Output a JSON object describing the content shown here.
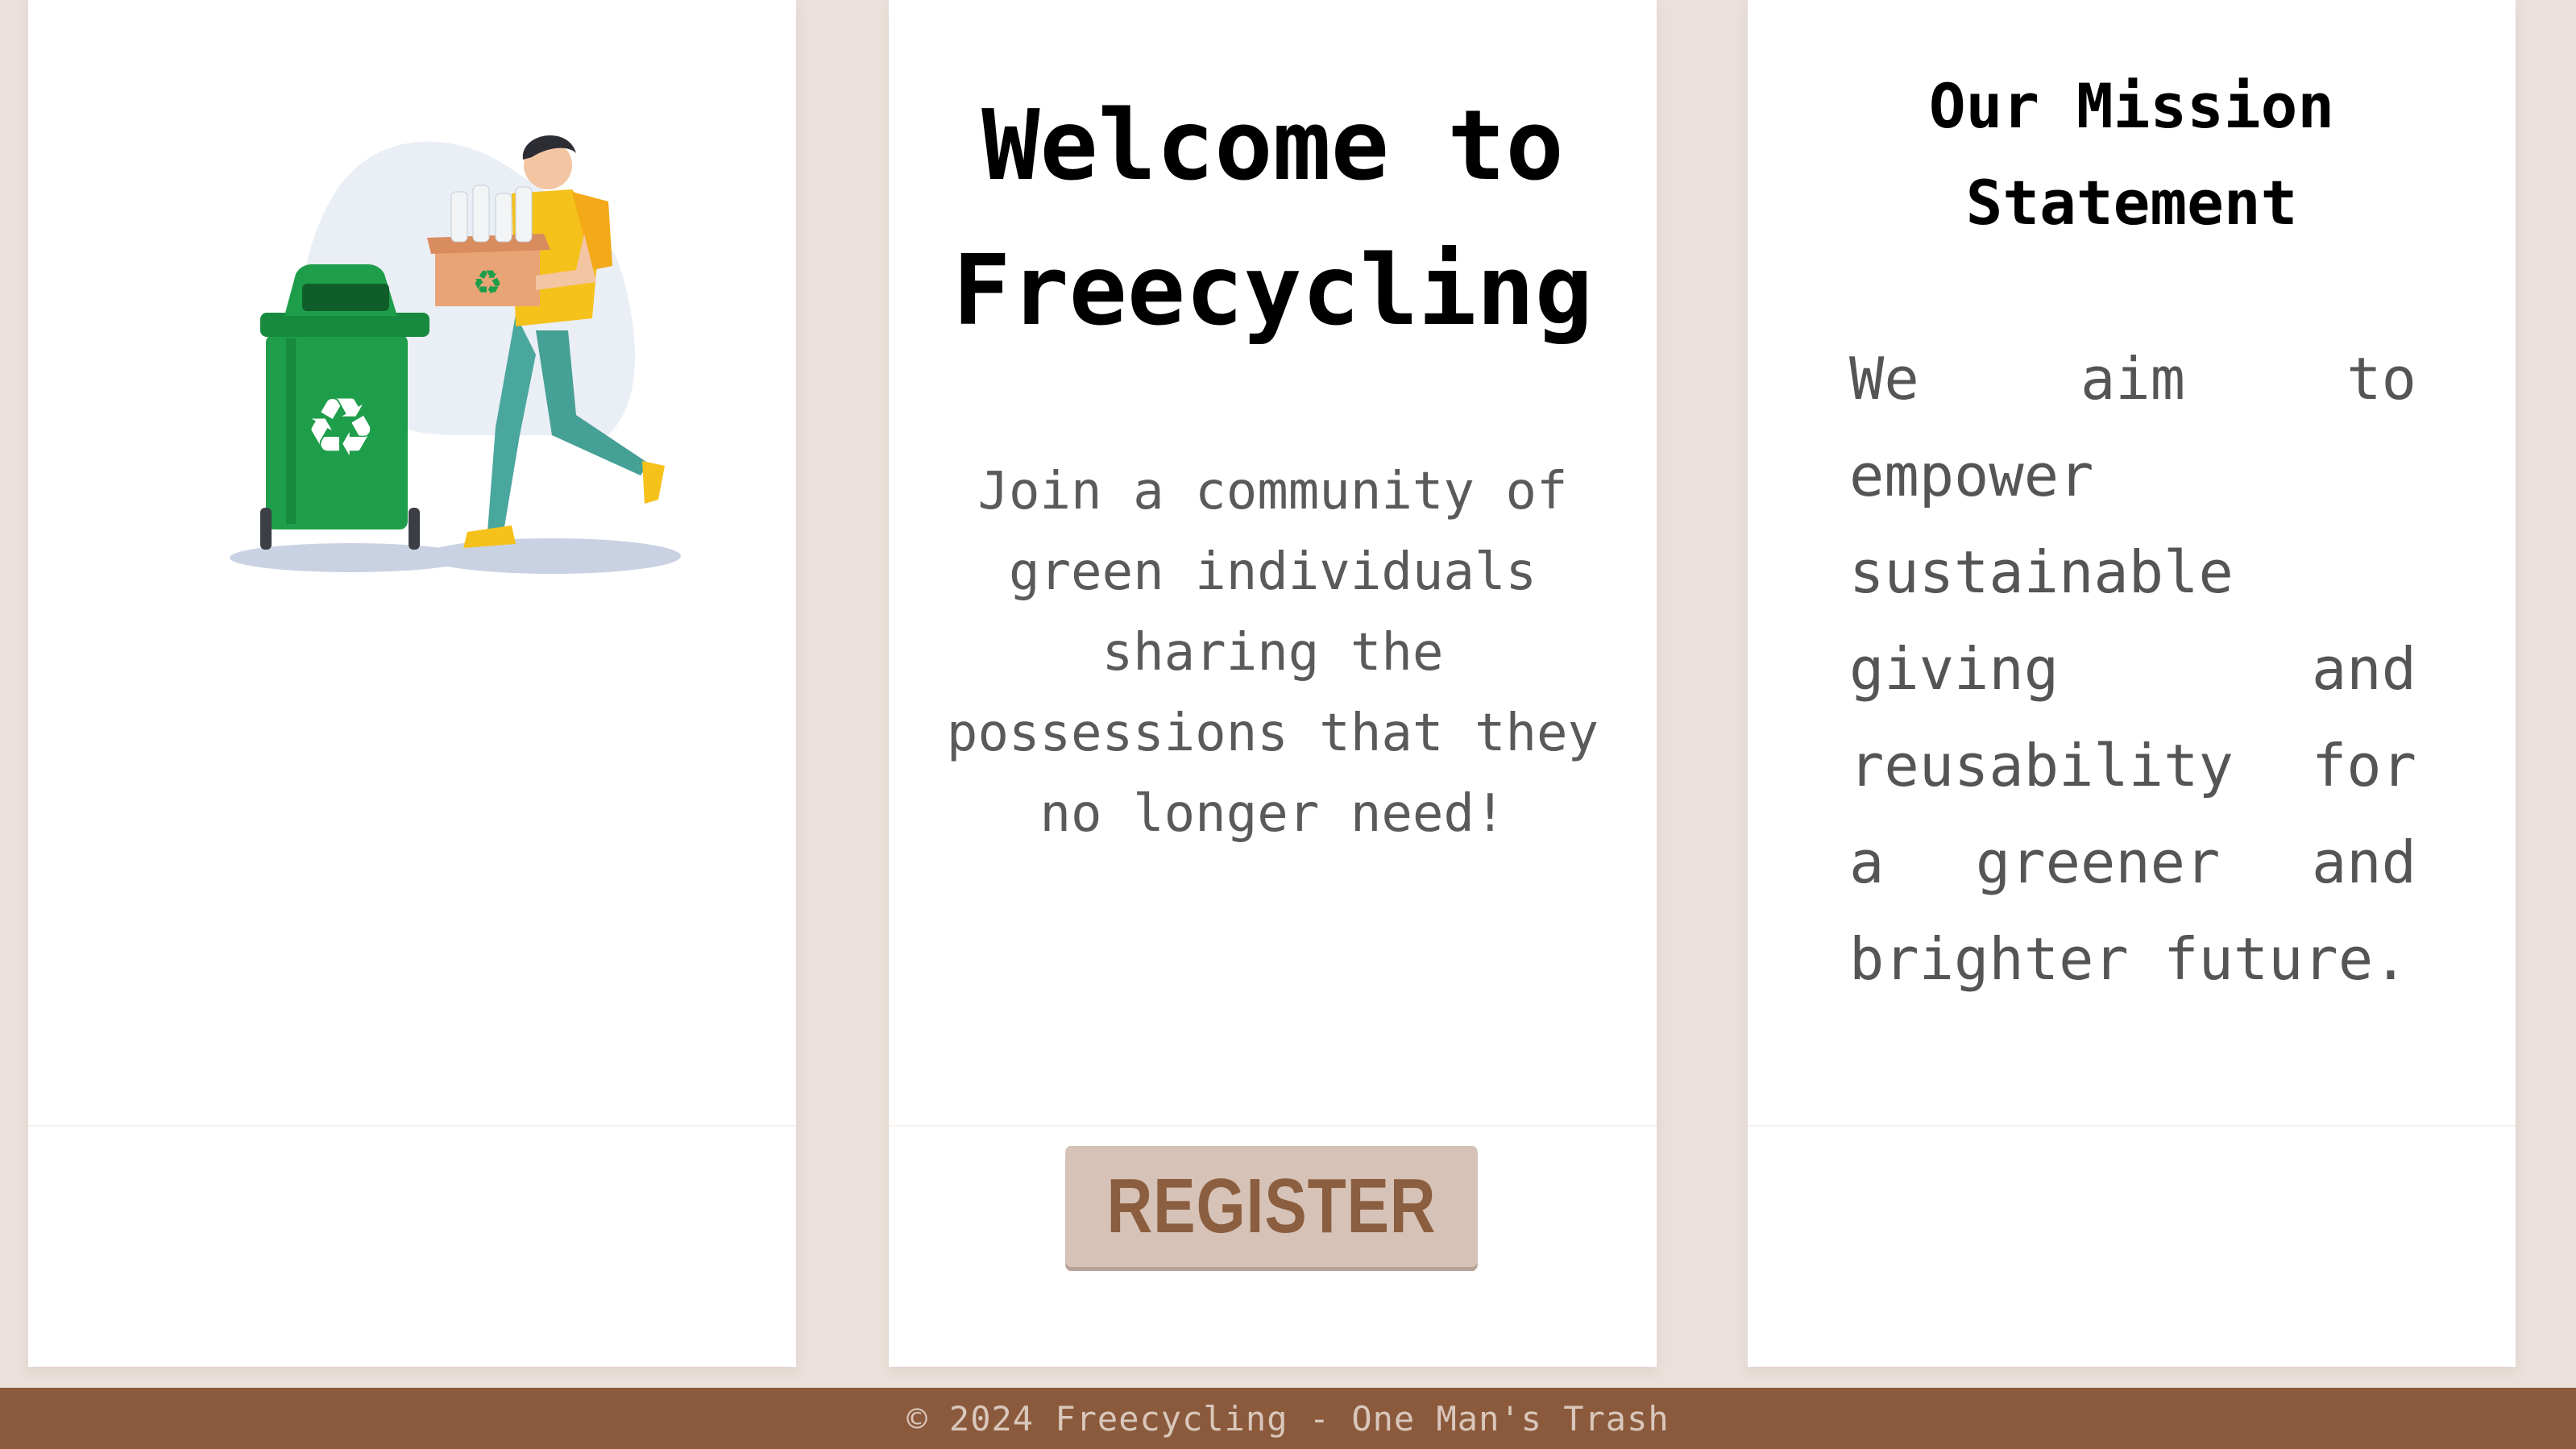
{
  "left_card": {
    "illustration": "person-carrying-recycling-box-next-to-green-recycling-bin"
  },
  "hero": {
    "title_line1": "Welcome to",
    "title_line2": "Freecycling",
    "subtitle_lines": [
      "Join a community of",
      "green individuals",
      "sharing the",
      "possessions that they",
      "no longer need!"
    ],
    "register_label": "REGISTER"
  },
  "mission": {
    "title_line1": "Our Mission",
    "title_line2": "Statement",
    "text": "We aim to empower sustainable giving and reusability for a greener and brighter future."
  },
  "footer": {
    "text": "© 2024 Freecycling - One Man's Trash"
  },
  "colors": {
    "background": "#ebe0db",
    "card": "#ffffff",
    "button_bg": "#d6c2b6",
    "button_text": "#8b5e3f",
    "footer_bg": "#8b5a3c",
    "bin_green": "#1e9e4a"
  }
}
